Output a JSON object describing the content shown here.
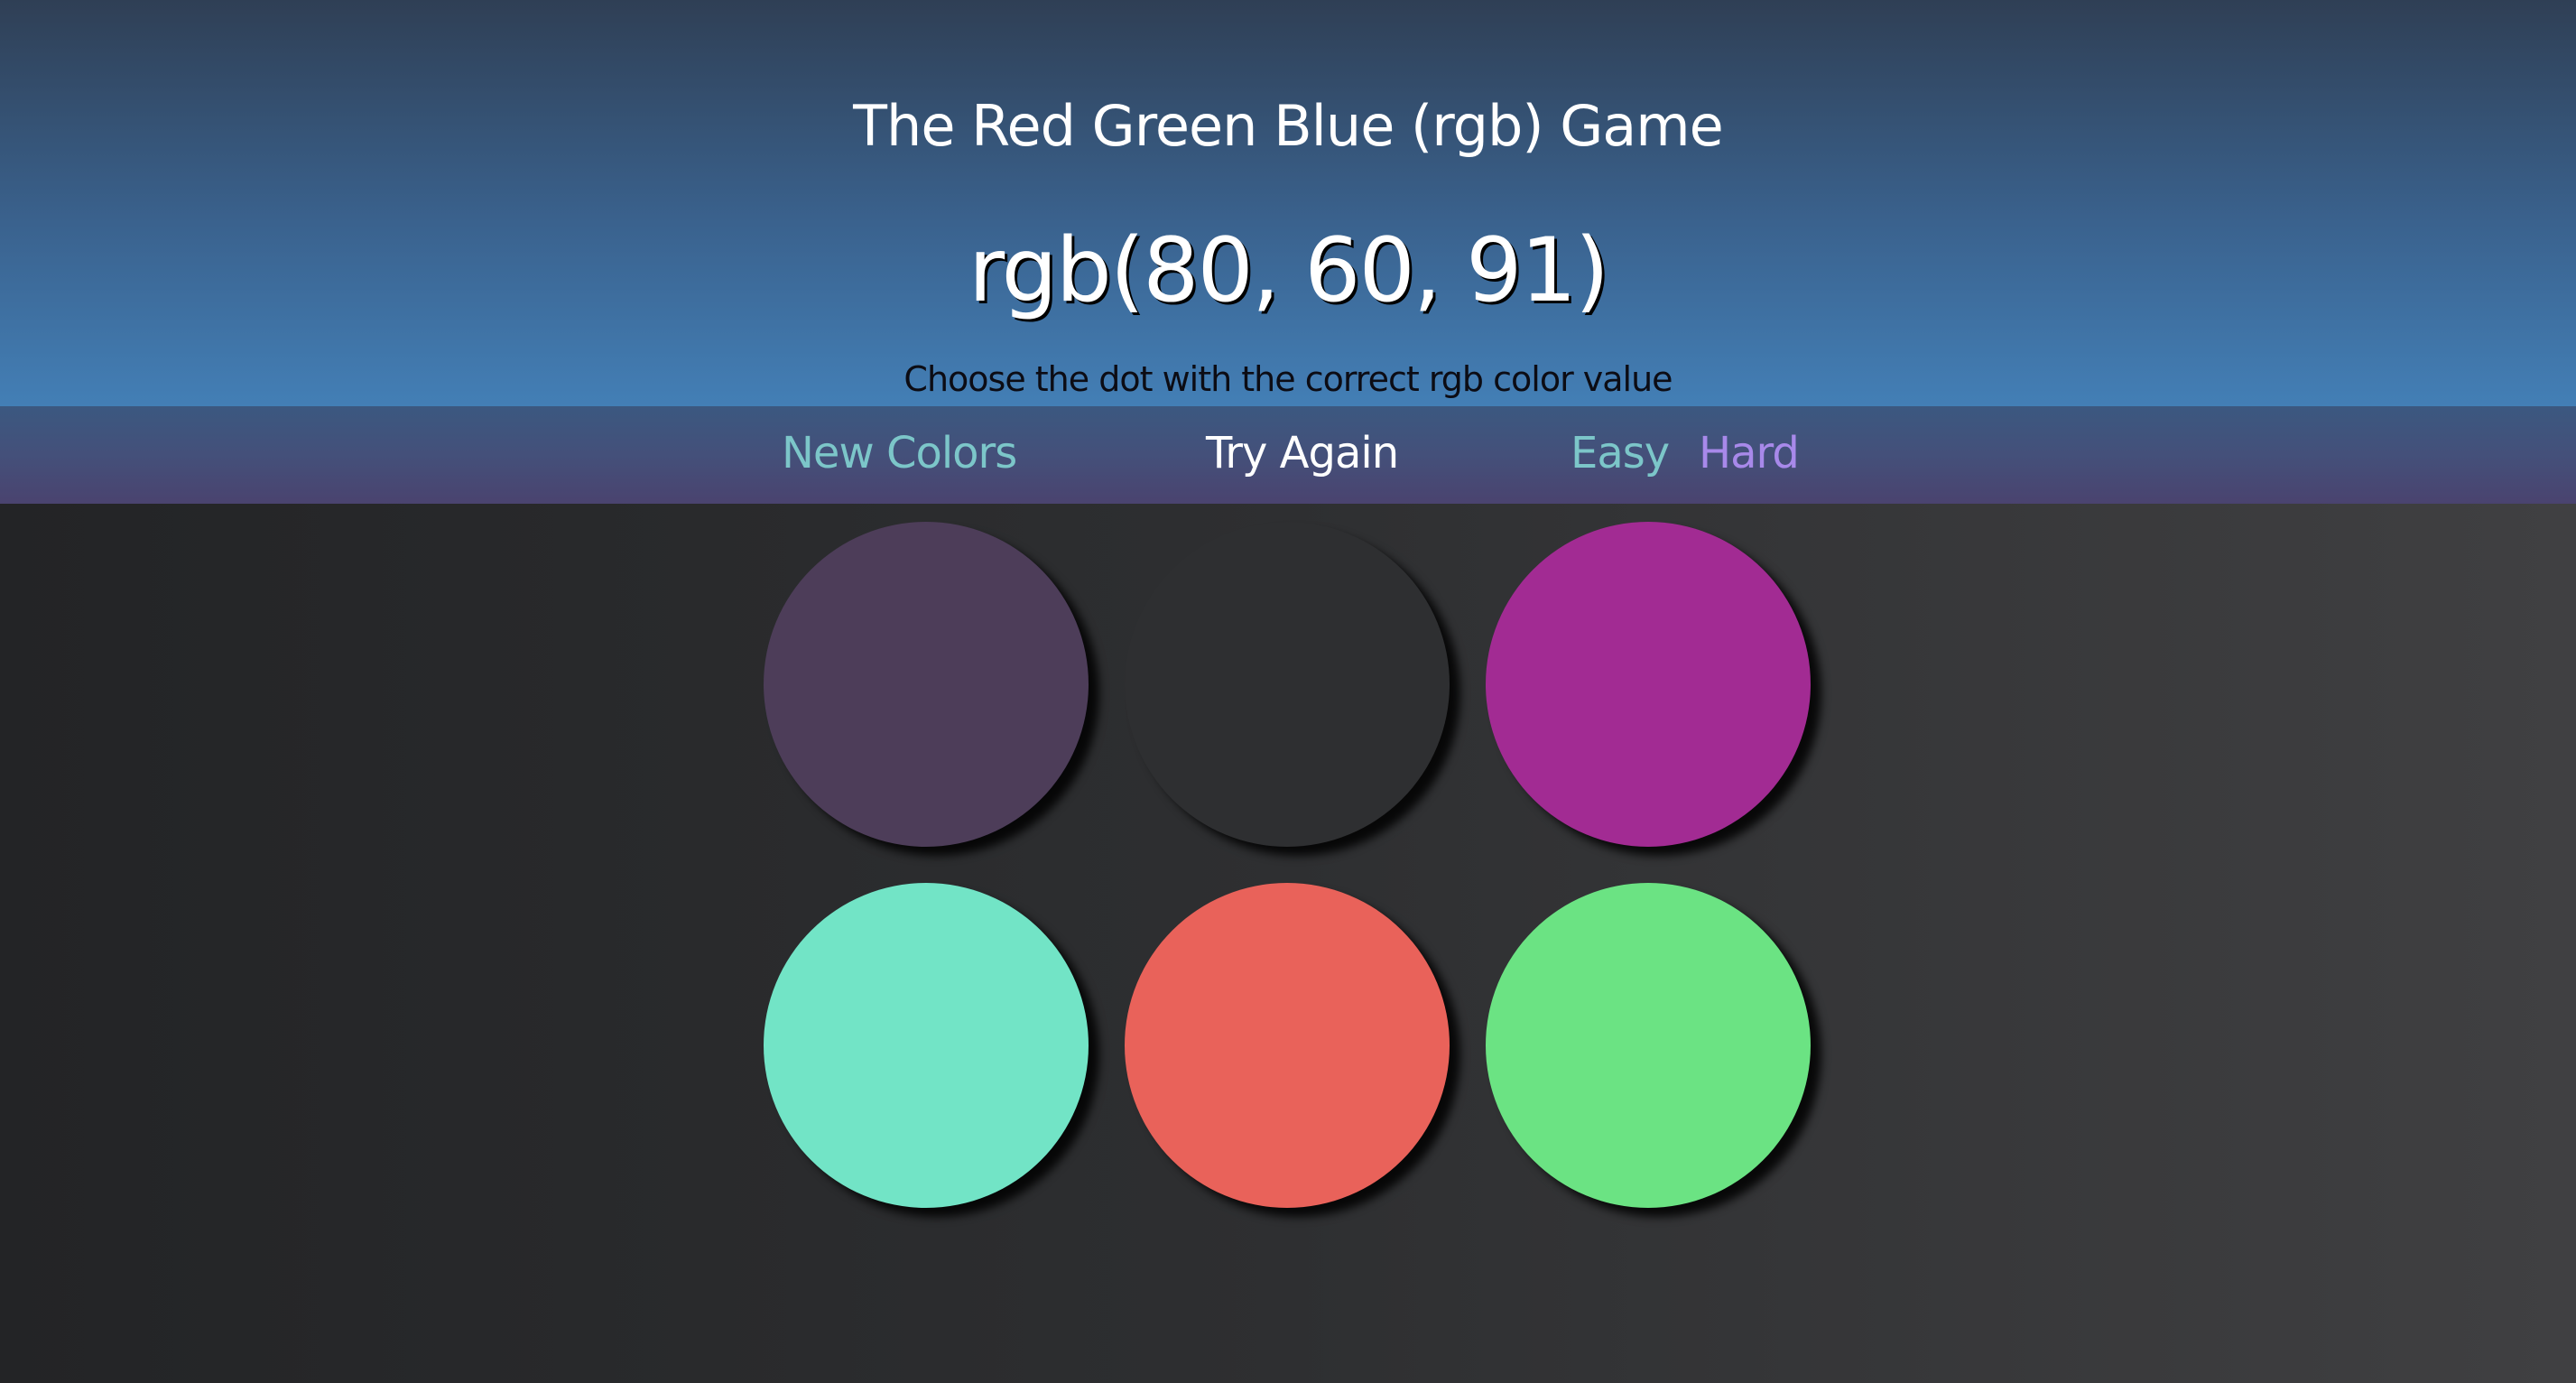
{
  "header": {
    "title": "The Red Green Blue (rgb) Game",
    "target_color": "rgb(80, 60, 91)",
    "message": "Choose the dot with the correct rgb color value"
  },
  "nav": {
    "new_colors_label": "New Colors",
    "try_again_label": "Try Again",
    "easy_label": "Easy",
    "hard_label": "Hard",
    "mode": "Hard"
  },
  "dots": [
    {
      "color": "#4d3d59",
      "hidden": false
    },
    {
      "color": "#2e2f31",
      "hidden": true
    },
    {
      "color": "#a22b93",
      "hidden": false
    },
    {
      "color": "#72e4c6",
      "hidden": false
    },
    {
      "color": "#e9625a",
      "hidden": false
    },
    {
      "color": "#6be383",
      "hidden": false
    }
  ],
  "colors": {
    "header_top": "#2f3f55",
    "header_bottom": "#437fb6",
    "nav_bar": "#44507a",
    "accent_teal": "#7cc6c9",
    "accent_purple": "#a889ea"
  }
}
